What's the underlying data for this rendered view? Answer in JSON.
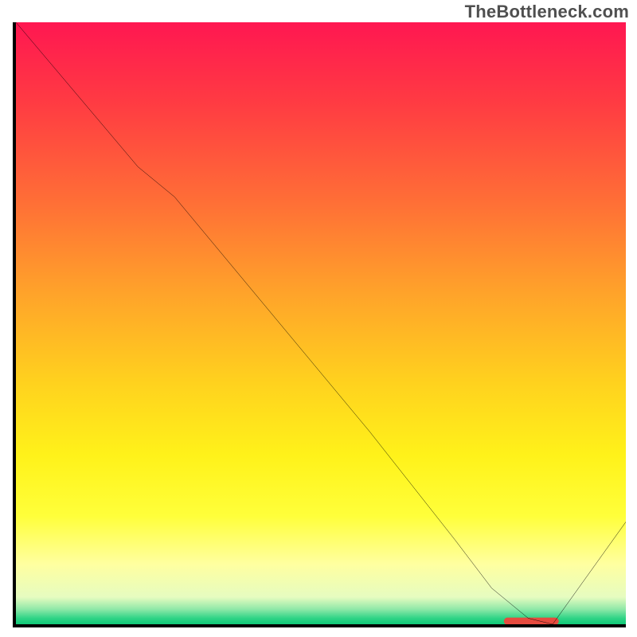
{
  "watermark": "TheBottleneck.com",
  "chart_data": {
    "type": "line",
    "title": "",
    "xlabel": "",
    "ylabel": "",
    "xlim": [
      0,
      100
    ],
    "ylim": [
      0,
      100
    ],
    "grid": false,
    "series": [
      {
        "name": "curve",
        "x": [
          0,
          20,
          26,
          58,
          72,
          78,
          84,
          88,
          100
        ],
        "values": [
          100,
          76,
          71,
          32,
          14,
          6,
          1,
          0,
          17
        ]
      }
    ],
    "marker_near_minimum": {
      "x_start": 80,
      "x_end": 89,
      "y": 0.5,
      "color": "#e64b3f"
    },
    "gradient_stops": [
      {
        "offset": 0.0,
        "color": "#ff1751"
      },
      {
        "offset": 0.13,
        "color": "#ff3a43"
      },
      {
        "offset": 0.3,
        "color": "#ff6f36"
      },
      {
        "offset": 0.45,
        "color": "#ffa32a"
      },
      {
        "offset": 0.6,
        "color": "#ffd21e"
      },
      {
        "offset": 0.72,
        "color": "#fff21a"
      },
      {
        "offset": 0.82,
        "color": "#ffff3a"
      },
      {
        "offset": 0.9,
        "color": "#ffffa0"
      },
      {
        "offset": 0.955,
        "color": "#e6fcc0"
      },
      {
        "offset": 0.975,
        "color": "#8fe8a8"
      },
      {
        "offset": 0.99,
        "color": "#2fd486"
      },
      {
        "offset": 1.0,
        "color": "#11c978"
      }
    ]
  }
}
